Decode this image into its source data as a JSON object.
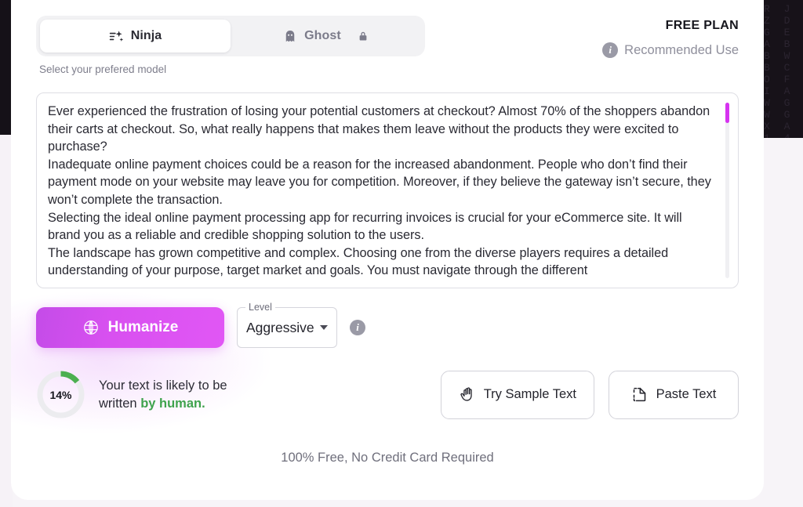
{
  "background": {
    "ghost_letters": "R J H\nZ D G\nG E Z\nA B Z\nB W C\nB C Q\nO F V\nI A U\nW G Z\nW G Z\nX A E\n1 4 E\nV 4 R"
  },
  "tabs": {
    "hint": "Select your prefered model",
    "items": [
      {
        "label": "Ninja",
        "icon": "sparkle-icon",
        "active": true,
        "locked": false
      },
      {
        "label": "Ghost",
        "icon": "ghost-icon",
        "active": false,
        "locked": true,
        "lock_icon": "lock-icon"
      }
    ]
  },
  "plan": {
    "name": "FREE PLAN",
    "recommended_label": "Recommended Use",
    "info_icon": "info-icon"
  },
  "editor": {
    "paragraphs": [
      "Ever experienced the frustration of losing your potential customers at checkout? Almost 70% of the shoppers abandon their carts at checkout. So, what really happens that makes them leave without the products they were excited to purchase?",
      "Inadequate online payment choices could be a reason for the increased abandonment. People who don’t find their payment mode on your website may leave you for competition. Moreover, if they believe the gateway isn’t secure, they won’t complete the transaction.",
      "Selecting the ideal online payment processing app for recurring invoices is crucial for your eCommerce site. It will brand you as a reliable and credible shopping solution to the users.",
      "The landscape has grown competitive and complex. Choosing one from the diverse players requires a detailed understanding of your purpose, target market and goals. You must navigate through the different"
    ],
    "scrollbar_color": "#d633f0"
  },
  "controls": {
    "humanize_label": "Humanize",
    "humanize_icon": "brain-icon",
    "humanize_gradient_from": "#c44ce8",
    "humanize_gradient_to": "#e157f5",
    "level_legend": "Level",
    "level_value": "Aggressive",
    "level_caret_icon": "chevron-down-icon",
    "level_info_icon": "info-icon"
  },
  "result": {
    "percent_label": "14%",
    "percent_value": 14,
    "gauge_color": "#4caf50",
    "gauge_track_color": "#ececef",
    "text_line1": "Your text is likely to be",
    "text_line2_prefix": "written ",
    "text_line2_highlight": "by human.",
    "highlight_color": "#3fa34d"
  },
  "actions": [
    {
      "label": "Try Sample Text",
      "icon": "wave-hand-icon"
    },
    {
      "label": "Paste Text",
      "icon": "paste-icon"
    }
  ],
  "footer": {
    "note": "100% Free, No Credit Card Required"
  }
}
